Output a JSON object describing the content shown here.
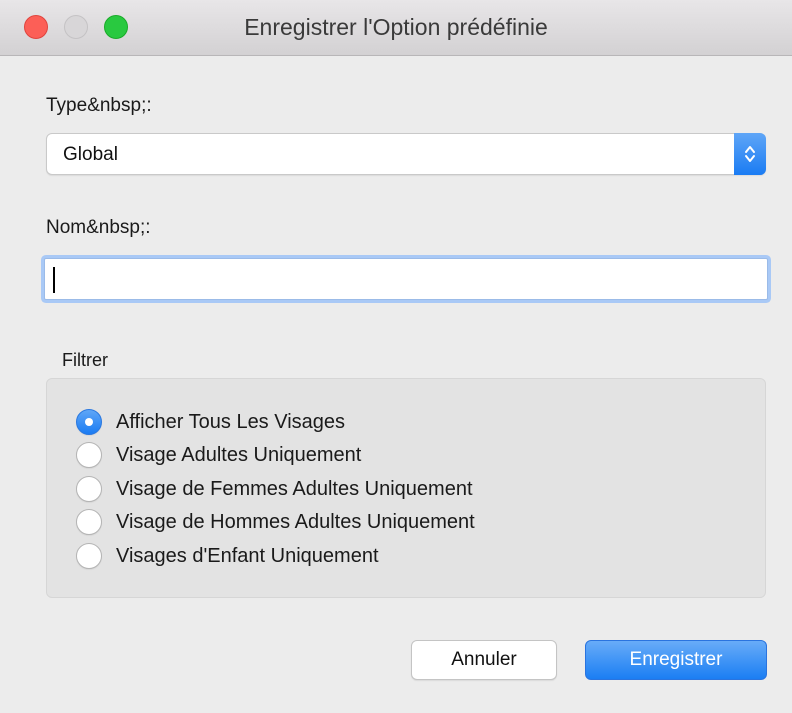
{
  "window": {
    "title": "Enregistrer l'Option prédéfinie"
  },
  "type_field": {
    "label": "Type&nbsp;:",
    "selected_value": "Global"
  },
  "name_field": {
    "label": "Nom&nbsp;:",
    "value": ""
  },
  "filter": {
    "title": "Filtrer",
    "options": [
      {
        "label": "Afficher Tous Les Visages",
        "checked": true
      },
      {
        "label": "Visage Adultes Uniquement",
        "checked": false
      },
      {
        "label": "Visage de Femmes Adultes Uniquement",
        "checked": false
      },
      {
        "label": "Visage de Hommes Adultes Uniquement",
        "checked": false
      },
      {
        "label": "Visages d'Enfant Uniquement",
        "checked": false
      }
    ]
  },
  "buttons": {
    "cancel": "Annuler",
    "save": "Enregistrer"
  },
  "colors": {
    "accent": "#1a7cf3",
    "close": "#fc5f57",
    "zoom": "#29c940"
  }
}
